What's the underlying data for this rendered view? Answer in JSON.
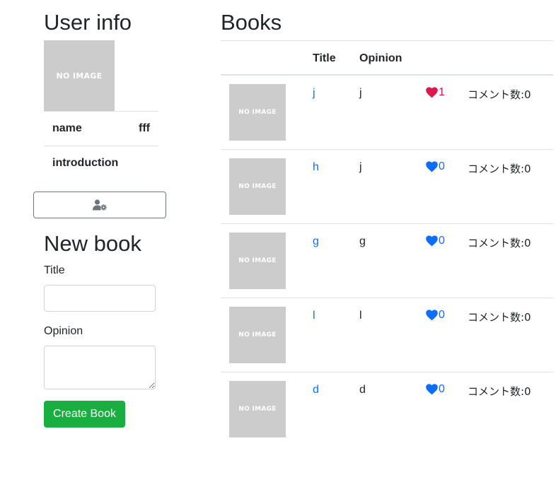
{
  "user": {
    "heading": "User info",
    "avatar_text": "NO IMAGE",
    "name_label": "name",
    "name_value": "fff",
    "introduction_label": "introduction",
    "introduction_value": "",
    "edit_icon": "user-cog-icon"
  },
  "new_book": {
    "heading": "New book",
    "title_label": "Title",
    "title_value": "",
    "opinion_label": "Opinion",
    "opinion_value": "",
    "submit_label": "Create Book",
    "submit_color": "#1aad3f"
  },
  "books": {
    "heading": "Books",
    "columns": [
      "",
      "Title",
      "Opinion",
      "",
      ""
    ],
    "thumb_text": "NO IMAGE",
    "link_color": "#0d6efd",
    "rows": [
      {
        "title": "j",
        "opinion": "j",
        "favorites": "1",
        "favorited": true,
        "comments": "コメント数:0"
      },
      {
        "title": "h",
        "opinion": "j",
        "favorites": "0",
        "favorited": false,
        "comments": "コメント数:0"
      },
      {
        "title": "g",
        "opinion": "g",
        "favorites": "0",
        "favorited": false,
        "comments": "コメント数:0"
      },
      {
        "title": "l",
        "opinion": "l",
        "favorites": "0",
        "favorited": false,
        "comments": "コメント数:0"
      },
      {
        "title": "d",
        "opinion": "d",
        "favorites": "0",
        "favorited": false,
        "comments": "コメント数:0"
      }
    ],
    "favorited_color": "#e0174f",
    "unfavorited_color": "#0d6efd"
  }
}
